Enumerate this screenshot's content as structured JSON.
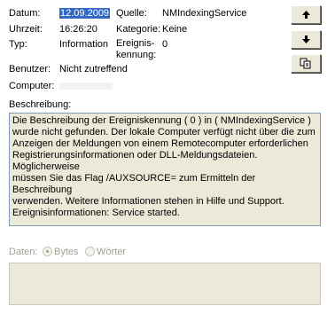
{
  "event": {
    "date_label": "Datum:",
    "date_value": "12.09.2009",
    "time_label": "Uhrzeit:",
    "time_value": "16:26:20",
    "type_label": "Typ:",
    "type_value": "Information",
    "user_label": "Benutzer:",
    "user_value": "Nicht zutreffend",
    "computer_label": "Computer:",
    "source_label": "Quelle:",
    "source_value": "NMIndexingService",
    "category_label": "Kategorie:",
    "category_value": "Keine",
    "eventid_label_1": "Ereignis-",
    "eventid_label_2": "kennung:",
    "eventid_value": "0"
  },
  "description": {
    "label": "Beschreibung:",
    "lines": [
      "Die Beschreibung der Ereigniskennung ( 0 ) in ( NMIndexingService )",
      "wurde nicht gefunden. Der lokale Computer verfügt nicht über die zum",
      "Anzeigen der Meldungen von einem Remotecomputer erforderlichen",
      "Registrierungsinformationen oder DLL-Meldungsdateien. Möglicherweise",
      "müssen Sie das Flag /AUXSOURCE= zum Ermitteln der Beschreibung",
      "verwenden. Weitere Informationen stehen in Hilfe und Support.",
      "Ereignisinformationen: Service started."
    ]
  },
  "data": {
    "label": "Daten:",
    "radio_bytes": "Bytes",
    "radio_words": "Wörter",
    "selected": "Bytes"
  },
  "buttons": {
    "up_icon": "arrow-up",
    "down_icon": "arrow-down",
    "copy_icon": "copy"
  }
}
